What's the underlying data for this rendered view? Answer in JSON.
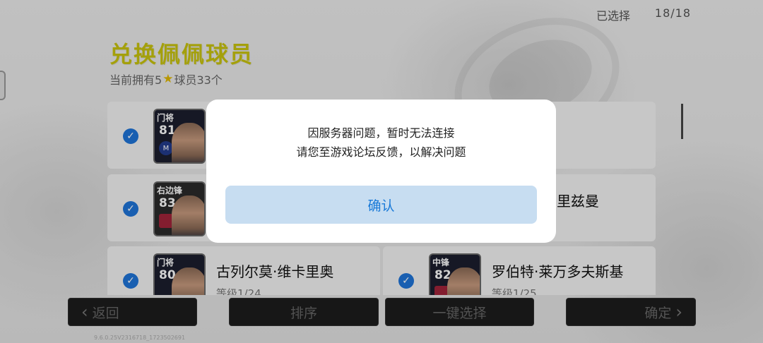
{
  "header": {
    "selected_label": "已选择",
    "selected_count": "18/18",
    "title": "兑换佩佩球员",
    "subtitle_prefix": "当前拥有5",
    "subtitle_suffix": "球员33个"
  },
  "players": [
    {
      "position": "门将",
      "rating": "81",
      "club": "M",
      "name": "",
      "level": ""
    },
    {
      "position": "右边锋",
      "rating": "83",
      "club": "",
      "name": "里兹曼",
      "level": ""
    },
    {
      "position": "门将",
      "rating": "80",
      "club": "",
      "name": "古列尔莫·维卡里奥",
      "level": "等级1/24"
    },
    {
      "position": "中锋",
      "rating": "82",
      "club": "",
      "name": "罗伯特·莱万多夫斯基",
      "level": "等级1/25"
    }
  ],
  "bottom": {
    "back_label": "返回",
    "sort_label": "排序",
    "select_all_label": "一键选择",
    "confirm_label": "确定"
  },
  "version": "9.6.0.25V2316718_1723502691",
  "dialog": {
    "line1": "因服务器问题，暂时无法连接",
    "line2": "请您至游戏论坛反馈，以解决问题",
    "ok_label": "确认"
  },
  "colors": {
    "title": "#c9c40e",
    "check": "#1f74d8",
    "ok_bg": "#c7ddf1",
    "ok_text": "#1a7ad8"
  }
}
